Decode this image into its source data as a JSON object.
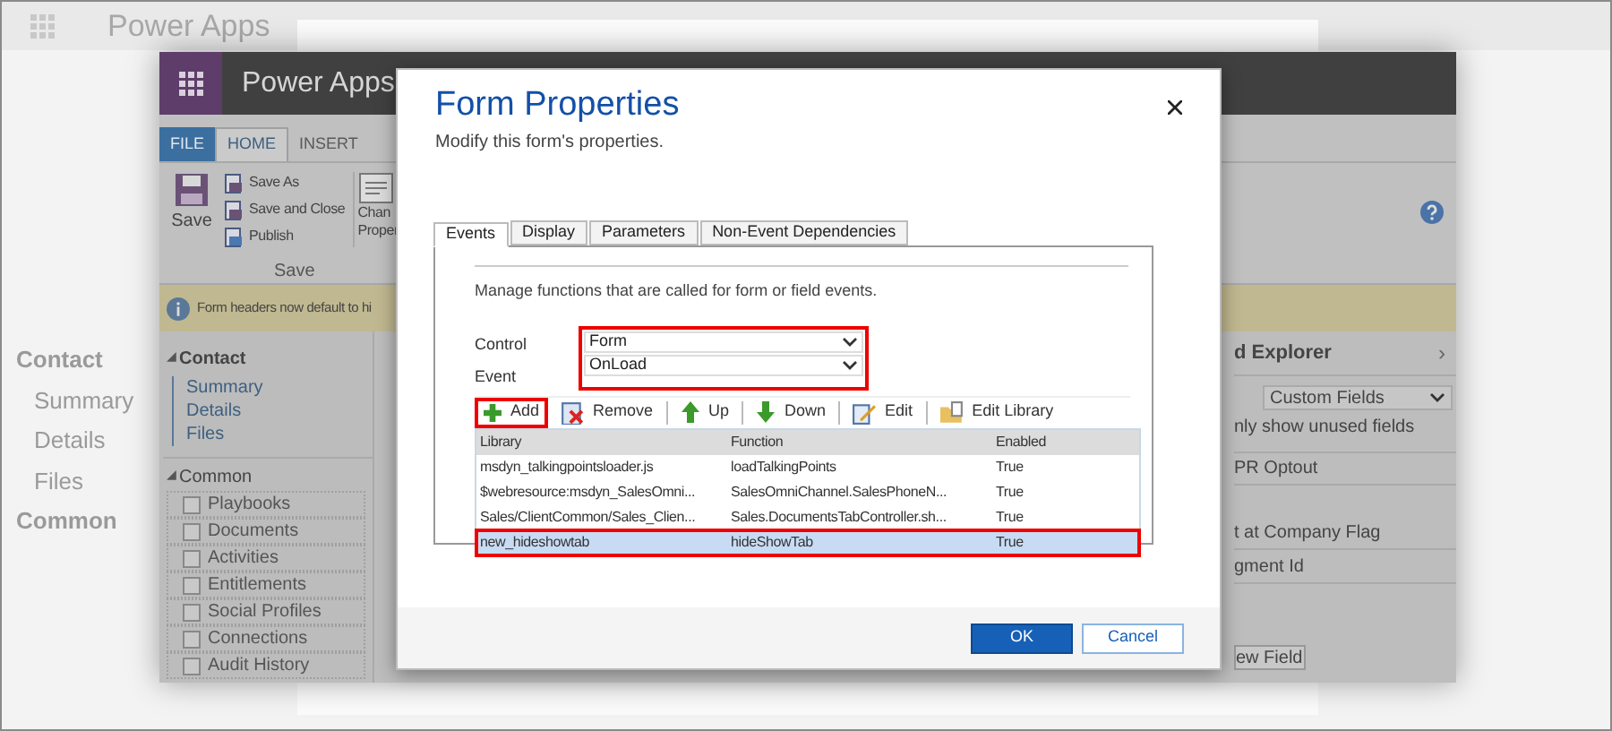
{
  "backdrop": {
    "app_title": "Power Apps",
    "nav": [
      "Contact",
      "Summary",
      "Details",
      "Files",
      "Common"
    ]
  },
  "app_window": {
    "title": "Power Apps",
    "ribbon_tabs": [
      {
        "label": "FILE",
        "kind": "file",
        "selected": false
      },
      {
        "label": "HOME",
        "kind": "tab",
        "selected": true
      },
      {
        "label": "INSERT",
        "kind": "tab",
        "selected": false
      }
    ],
    "save_button": "Save",
    "small_buttons": [
      "Save As",
      "Save and Close",
      "Publish"
    ],
    "group_label": "Save",
    "change_button": [
      "Chan",
      "Proper"
    ],
    "notice": "Form headers now default to hi",
    "expander": "◢",
    "nav_section": "Contact",
    "nav_links": [
      "Summary",
      "Details",
      "Files"
    ],
    "common_section": "Common",
    "common_items": [
      "Playbooks",
      "Documents",
      "Activities",
      "Entitlements",
      "Social Profiles",
      "Connections",
      "Audit History"
    ],
    "explorer": {
      "title": "d Explorer",
      "chevron": "›",
      "filter": "Custom Fields",
      "checkbox_label": "nly show unused fields",
      "fields": [
        "PR Optout",
        "t at Company Flag",
        "gment Id"
      ],
      "new_field": "ew Field"
    }
  },
  "dialog": {
    "title": "Form Properties",
    "subtitle": "Modify this form's properties.",
    "tabs": [
      {
        "label": "Events",
        "selected": true
      },
      {
        "label": "Display",
        "selected": false
      },
      {
        "label": "Parameters",
        "selected": false
      },
      {
        "label": "Non-Event Dependencies",
        "selected": false
      }
    ],
    "description": "Manage functions that are called for form or field events.",
    "control": {
      "label": "Control",
      "value": "Form"
    },
    "event": {
      "label": "Event",
      "value": "OnLoad"
    },
    "toolbar": [
      {
        "label": "Add",
        "kind": "add",
        "highlighted": true
      },
      {
        "label": "Remove",
        "kind": "remove",
        "highlighted": false
      },
      {
        "label": "Up",
        "kind": "up",
        "highlighted": false
      },
      {
        "label": "Down",
        "kind": "down",
        "highlighted": false
      },
      {
        "label": "Edit",
        "kind": "edit",
        "highlighted": false
      },
      {
        "label": "Edit Library",
        "kind": "library",
        "highlighted": false
      }
    ],
    "table": {
      "columns": [
        "Library",
        "Function",
        "Enabled"
      ],
      "rows": [
        {
          "cells": [
            "msdyn_talkingpointsloader.js",
            "loadTalkingPoints",
            "True"
          ],
          "selected": false
        },
        {
          "cells": [
            "$webresource:msdyn_SalesOmni...",
            "SalesOmniChannel.SalesPhoneN...",
            "True"
          ],
          "selected": false
        },
        {
          "cells": [
            "Sales/ClientCommon/Sales_Clien...",
            "Sales.DocumentsTabController.sh...",
            "True"
          ],
          "selected": false
        },
        {
          "cells": [
            "new_hideshowtab",
            "hideShowTab",
            "True"
          ],
          "selected": true
        }
      ]
    },
    "buttons": [
      "OK",
      "Cancel"
    ]
  }
}
